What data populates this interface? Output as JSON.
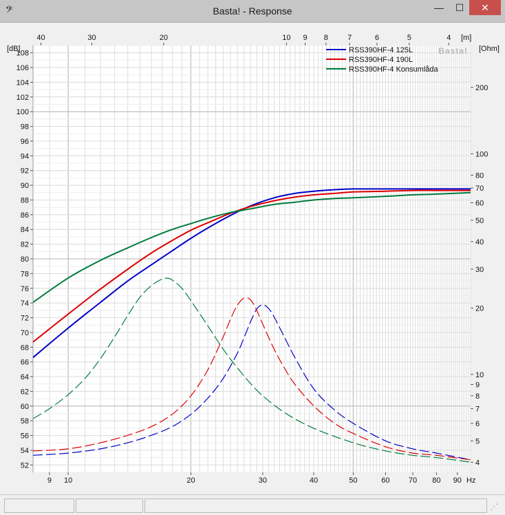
{
  "window": {
    "title": "Basta! - Response",
    "app_icon": "bass-clef-icon",
    "controls": {
      "minimize": "—",
      "maximize": "☐",
      "close": "✕"
    }
  },
  "colors": {
    "series_125L": "#0000c8",
    "series_190L": "#dd0000",
    "series_box": "#007a3c",
    "grid": "#dcdcdc",
    "grid_major": "#b4b4b4"
  },
  "chart_data": {
    "type": "line",
    "watermark": "Basta!",
    "y_left": {
      "label": "[dB]",
      "range": [
        51,
        109
      ],
      "ticks": [
        52,
        54,
        56,
        58,
        60,
        62,
        64,
        66,
        68,
        70,
        72,
        74,
        76,
        78,
        80,
        82,
        84,
        86,
        88,
        90,
        92,
        94,
        96,
        98,
        100,
        102,
        104,
        106,
        108
      ]
    },
    "y_right": {
      "label": "[Ohm]",
      "scale": "log",
      "range": [
        3.6,
        310
      ],
      "ticks": [
        4,
        5,
        6,
        7,
        8,
        9,
        10,
        20,
        30,
        40,
        50,
        60,
        70,
        80,
        100,
        200
      ]
    },
    "x_bottom": {
      "label": "Hz",
      "scale": "log",
      "range": [
        8.2,
        97
      ],
      "ticks": [
        9,
        10,
        20,
        30,
        40,
        50,
        60,
        70,
        80,
        90
      ],
      "major": [
        10,
        20,
        50
      ]
    },
    "x_top": {
      "label": "[m]",
      "ticks": [
        {
          "label": "40",
          "hz": 8.575
        },
        {
          "label": "30",
          "hz": 11.43
        },
        {
          "label": "20",
          "hz": 17.15
        },
        {
          "label": "10",
          "hz": 34.3
        },
        {
          "label": "9",
          "hz": 38.11
        },
        {
          "label": "8",
          "hz": 42.875
        },
        {
          "label": "7",
          "hz": 49.0
        },
        {
          "label": "6",
          "hz": 57.17
        },
        {
          "label": "5",
          "hz": 68.6
        },
        {
          "label": "4",
          "hz": 85.75
        }
      ]
    },
    "legend": {
      "position": "top-right"
    },
    "series": [
      {
        "name": "RSS390HF-4 125L",
        "color": "#0000c8",
        "axis": "left",
        "style": "solid",
        "x": [
          8.2,
          10,
          12,
          14,
          16,
          18,
          20,
          22,
          25,
          28,
          32,
          36,
          40,
          45,
          50,
          60,
          70,
          80,
          97
        ],
        "y": [
          66.6,
          70.6,
          74.1,
          77.0,
          79.2,
          81.1,
          82.8,
          84.2,
          85.9,
          87.2,
          88.3,
          88.9,
          89.2,
          89.4,
          89.5,
          89.5,
          89.5,
          89.5,
          89.5
        ]
      },
      {
        "name": "RSS390HF-4 190L",
        "color": "#dd0000",
        "axis": "left",
        "style": "solid",
        "x": [
          8.2,
          10,
          12,
          14,
          16,
          18,
          20,
          22,
          25,
          28,
          32,
          36,
          40,
          45,
          50,
          60,
          70,
          80,
          97
        ],
        "y": [
          68.7,
          72.5,
          75.9,
          78.6,
          80.8,
          82.5,
          83.9,
          84.9,
          86.2,
          87.1,
          87.9,
          88.4,
          88.7,
          88.9,
          89.1,
          89.2,
          89.3,
          89.3,
          89.3
        ]
      },
      {
        "name": "RSS390HF-4 Konsumlåda",
        "color": "#007a3c",
        "axis": "left",
        "style": "solid",
        "x": [
          8.2,
          10,
          12,
          14,
          16,
          18,
          20,
          22,
          25,
          28,
          32,
          36,
          40,
          45,
          50,
          60,
          70,
          80,
          97
        ],
        "y": [
          74.1,
          77.4,
          79.8,
          81.5,
          82.9,
          84.0,
          84.8,
          85.5,
          86.3,
          86.8,
          87.4,
          87.7,
          88.0,
          88.2,
          88.3,
          88.5,
          88.7,
          88.8,
          89.0
        ]
      },
      {
        "name": "RSS390HF-4 125L",
        "color": "#0000c8",
        "axis": "right",
        "style": "dashed",
        "x": [
          8.2,
          10,
          12,
          14,
          16,
          18,
          20,
          22,
          24,
          26,
          27,
          28,
          29,
          30,
          31,
          32,
          34,
          36,
          40,
          45,
          50,
          60,
          70,
          80,
          97
        ],
        "y": [
          4.3,
          4.4,
          4.6,
          4.9,
          5.3,
          5.8,
          6.6,
          7.8,
          9.6,
          12.5,
          14.7,
          17.3,
          19.8,
          20.7,
          19.9,
          18.2,
          14.6,
          11.9,
          8.6,
          6.9,
          6.0,
          5.0,
          4.6,
          4.4,
          4.1
        ]
      },
      {
        "name": "RSS390HF-4 190L",
        "color": "#dd0000",
        "axis": "right",
        "style": "dashed",
        "x": [
          8.2,
          10,
          12,
          14,
          16,
          18,
          20,
          22,
          24,
          25,
          26,
          27,
          28,
          29,
          30,
          32,
          34,
          36,
          40,
          45,
          50,
          60,
          70,
          80,
          97
        ],
        "y": [
          4.5,
          4.6,
          4.9,
          5.3,
          5.8,
          6.6,
          8.0,
          10.5,
          14.8,
          17.8,
          20.6,
          22.2,
          21.8,
          19.5,
          16.9,
          13.0,
          10.6,
          9.0,
          7.2,
          6.0,
          5.4,
          4.7,
          4.4,
          4.3,
          4.1
        ]
      },
      {
        "name": "RSS390HF-4 Konsumlåda",
        "color": "#007a3c",
        "axis": "right",
        "style": "dashed",
        "x": [
          8.2,
          9,
          10,
          11,
          12,
          13,
          14,
          15,
          16,
          17,
          17.5,
          18,
          19,
          20,
          22,
          24,
          26,
          28,
          30,
          34,
          40,
          50,
          60,
          70,
          80,
          97
        ],
        "y": [
          6.3,
          7.0,
          8.1,
          9.6,
          11.8,
          14.8,
          18.5,
          22.4,
          25.3,
          27.1,
          27.3,
          26.8,
          24.6,
          21.6,
          16.6,
          13.0,
          10.7,
          9.1,
          8.0,
          6.7,
          5.7,
          4.9,
          4.5,
          4.3,
          4.2,
          4.0
        ]
      }
    ]
  }
}
